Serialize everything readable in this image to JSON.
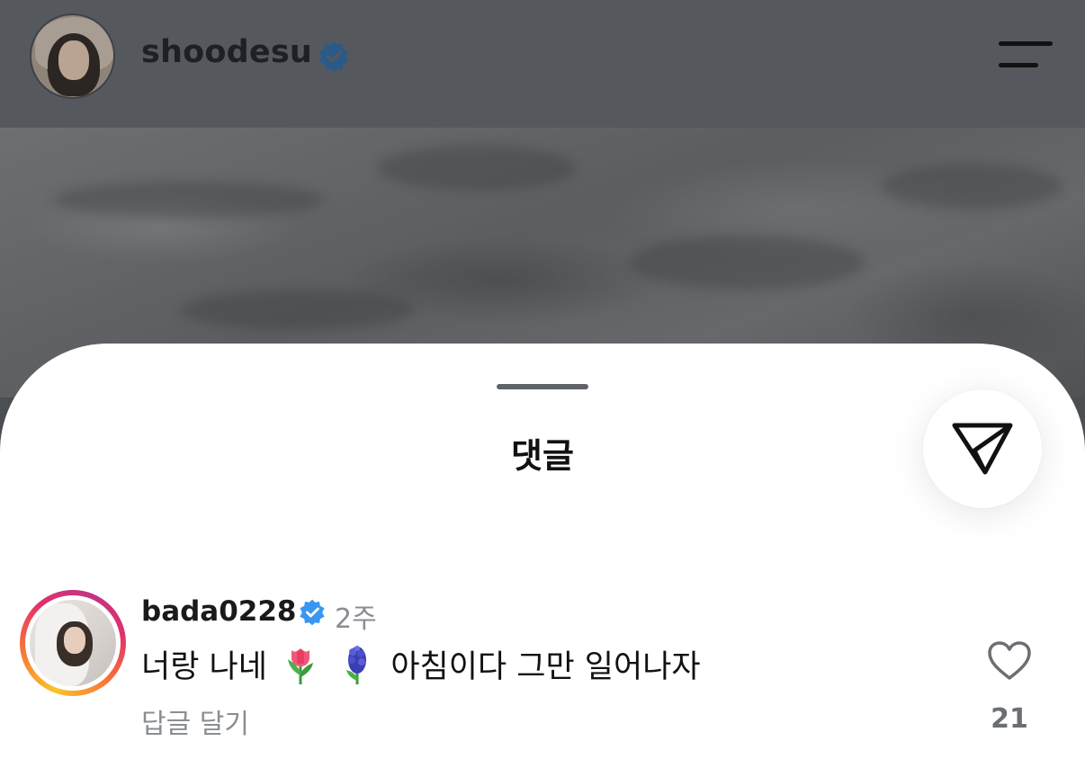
{
  "header": {
    "username": "shoodesu",
    "verified": true,
    "menu_icon": "hamburger-menu-icon",
    "avatar_icon": "profile-photo"
  },
  "sheet": {
    "title": "댓글",
    "share_icon": "send-icon"
  },
  "comments": [
    {
      "username": "bada0228",
      "verified": true,
      "time": "2주",
      "text_part1": "너랑 나네",
      "emoji1": "tulip",
      "emoji2": "hyacinth",
      "text_part2": "아침이다 그만 일어나자",
      "reply_label": "답글 달기",
      "likes": "21",
      "story_ring": true
    }
  ],
  "colors": {
    "verified_blue": "#3897f0",
    "dim_overlay": "#55585d",
    "secondary_text": "#8a8d91"
  }
}
